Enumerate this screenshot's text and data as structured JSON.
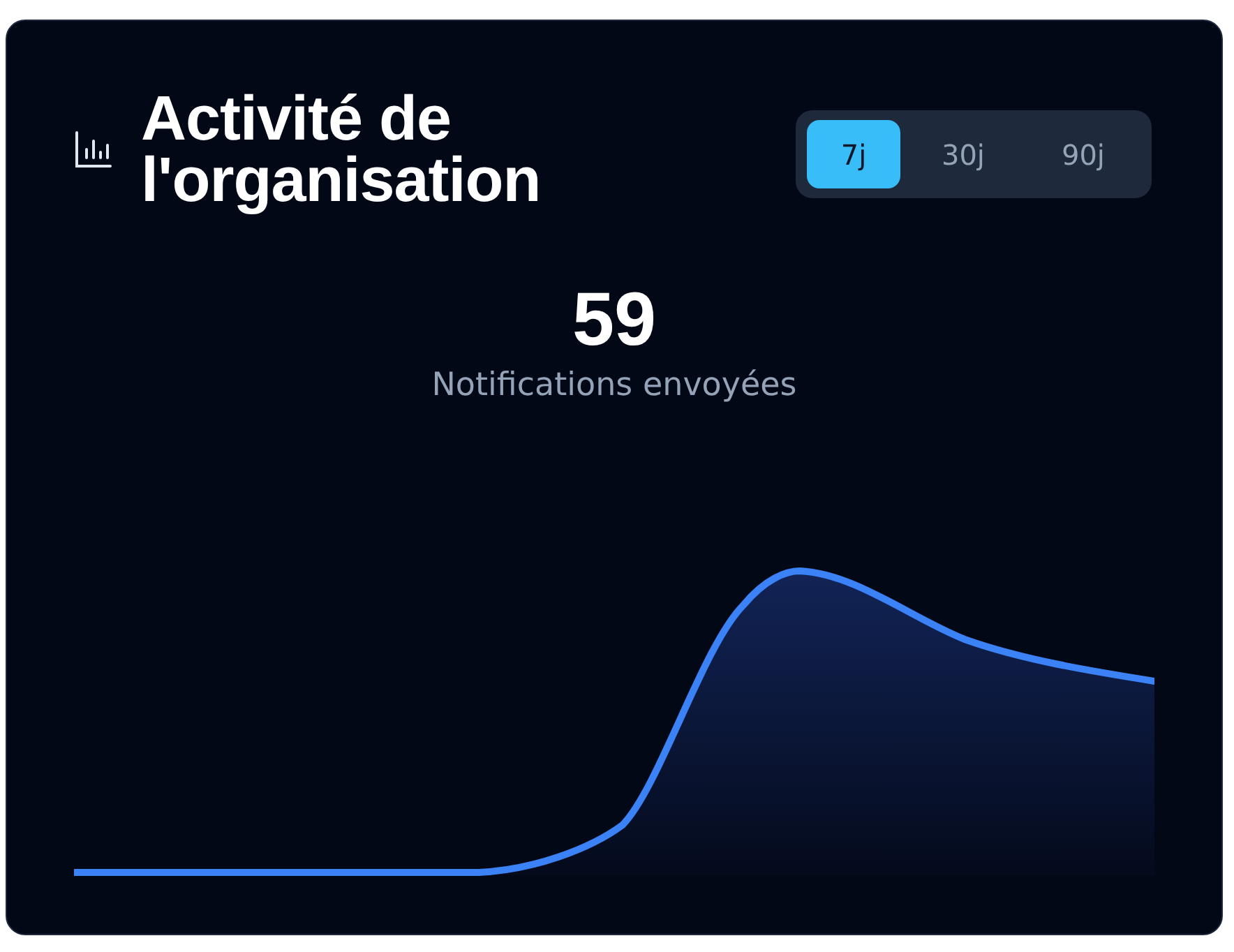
{
  "card": {
    "title": "Activité de l'organisation",
    "periods": [
      {
        "label": "7j",
        "selected": true
      },
      {
        "label": "30j",
        "selected": false
      },
      {
        "label": "90j",
        "selected": false
      }
    ],
    "total": "59",
    "total_label": "Notifications envoyées"
  }
}
